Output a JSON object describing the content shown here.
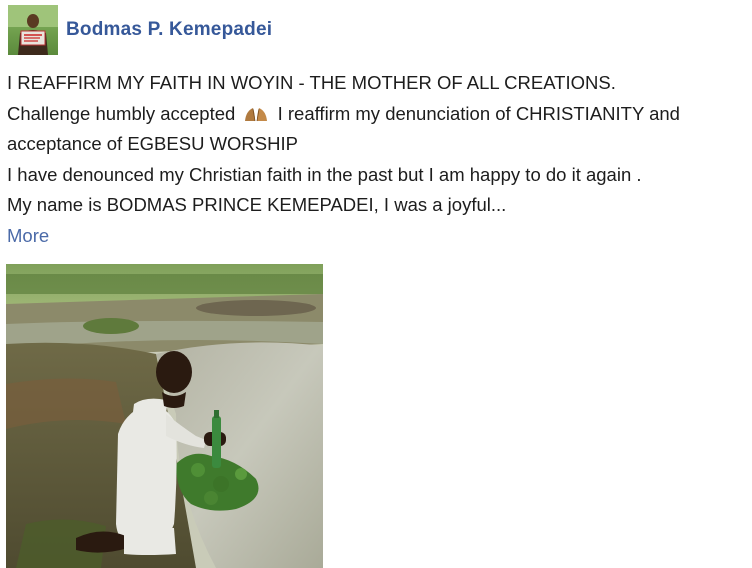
{
  "post": {
    "author_name": "Bodmas P.  Kemepadei",
    "avatar_icon": "profile-photo",
    "lines": [
      "I REAFFIRM MY FAITH IN WOYIN - THE MOTHER OF ALL CREATIONS.",
      "Challenge humbly accepted",
      "I reaffirm my denunciation of CHRISTIANITY and",
      "acceptance of EGBESU WORSHIP",
      "I have denounced my Christian faith in the past but I am happy to do it again .",
      "My name is BODMAS PRINCE KEMEPADEI,  I was a joyful..."
    ],
    "emoji_icon": "praying-hands-emoji",
    "more_label": "More",
    "photo_subject": "man-kneeling-by-water-photo"
  },
  "colors": {
    "author": "#365899",
    "more_link": "#4b6aa8",
    "text": "#1d1d1d"
  }
}
